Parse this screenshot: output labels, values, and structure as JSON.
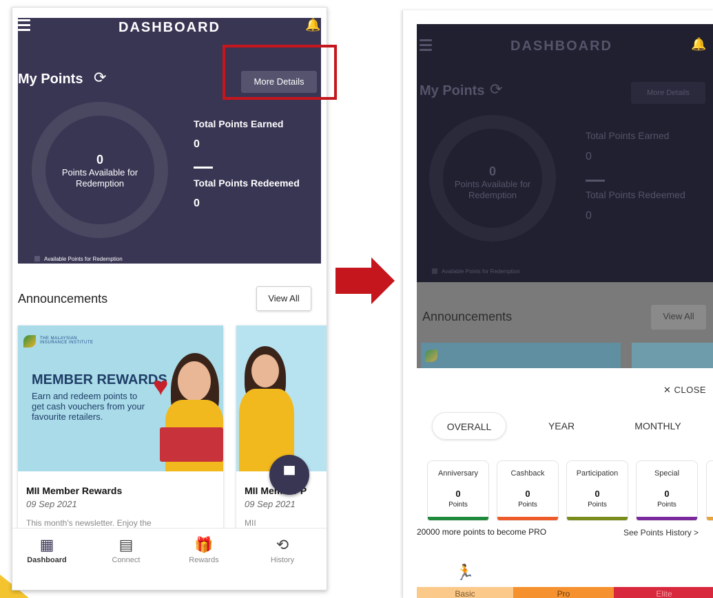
{
  "left": {
    "header_title": "DASHBOARD",
    "my_points": "My Points",
    "more_details": "More Details",
    "points_available_value": "0",
    "points_available_label": "Points Available for Redemption",
    "total_earned_label": "Total Points Earned",
    "total_earned_value": "0",
    "total_redeemed_label": "Total Points Redeemed",
    "total_redeemed_value": "0",
    "legend": "Available Points for Redemption",
    "announcements_title": "Announcements",
    "view_all": "View All",
    "banner": {
      "logo_text": "THE MALAYSIAN INSURANCE INSTITUTE",
      "title": "MEMBER REWARDS",
      "text": "Earn and redeem points to get cash vouchers from your favourite retailers."
    },
    "cards": [
      {
        "title": "MII Member Rewards",
        "date": "09 Sep 2021",
        "desc": "This month's newsletter. Enjoy the"
      },
      {
        "title": "MII Member P",
        "date": "09 Sep 2021",
        "desc": "MII"
      }
    ],
    "nav": [
      {
        "label": "Dashboard",
        "icon": "grid-icon"
      },
      {
        "label": "Connect",
        "icon": "document-icon"
      },
      {
        "label": "Rewards",
        "icon": "gift-icon"
      },
      {
        "label": "History",
        "icon": "history-icon"
      }
    ]
  },
  "right": {
    "header_title": "DASHBOARD",
    "my_points": "My Points",
    "more_details": "More Details",
    "points_available_value": "0",
    "points_available_label": "Points Available for Redemption",
    "total_earned_label": "Total Points Earned",
    "total_earned_value": "0",
    "total_redeemed_label": "Total Points Redeemed",
    "total_redeemed_value": "0",
    "legend": "Available Points for Redemption",
    "announcements_title": "Announcements",
    "view_all": "View All",
    "close": "✕ CLOSE",
    "tabs": [
      "OVERALL",
      "YEAR",
      "MONTHLY"
    ],
    "categories": [
      {
        "name": "Anniversary",
        "value": "0",
        "unit": "Points",
        "color": "#1f8a3c"
      },
      {
        "name": "Cashback",
        "value": "0",
        "unit": "Points",
        "color": "#ee5a2a"
      },
      {
        "name": "Participation",
        "value": "0",
        "unit": "Points",
        "color": "#7a8c1c"
      },
      {
        "name": "Special",
        "value": "0",
        "unit": "Points",
        "color": "#7a2a9c"
      }
    ],
    "pro_text": "20000 more points to become PRO",
    "history_link": "See Points History >",
    "tiers": [
      {
        "label": "Basic",
        "color": "#fbc98a"
      },
      {
        "label": "Pro",
        "color": "#f5922f"
      },
      {
        "label": "Elite",
        "color": "#d8283d"
      }
    ]
  },
  "colors": {
    "dashboard": "#393654",
    "highlight": "#c4161c"
  }
}
